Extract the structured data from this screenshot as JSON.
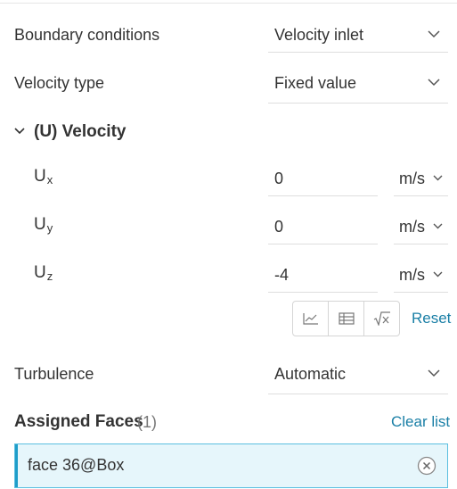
{
  "boundary": {
    "label": "Boundary conditions",
    "value": "Velocity inlet"
  },
  "velocity_type": {
    "label": "Velocity type",
    "value": "Fixed value"
  },
  "velocity_section": {
    "title": "(U) Velocity",
    "components": [
      {
        "name": "U",
        "sub": "x",
        "value": "0",
        "unit": "m/s"
      },
      {
        "name": "U",
        "sub": "y",
        "value": "0",
        "unit": "m/s"
      },
      {
        "name": "U",
        "sub": "z",
        "value": "-4",
        "unit": "m/s"
      }
    ],
    "toolbar_icons": [
      "chart-icon",
      "table-icon",
      "formula-icon"
    ],
    "reset_label": "Reset"
  },
  "turbulence": {
    "label": "Turbulence",
    "value": "Automatic"
  },
  "assigned_faces": {
    "title": "Assigned Faces",
    "count": "(1)",
    "clear_label": "Clear list",
    "items": [
      "face 36@Box"
    ]
  },
  "colors": {
    "accent": "#1a7fa6",
    "selected_bg": "#e6f6fb",
    "selected_border": "#5bbfe0"
  }
}
